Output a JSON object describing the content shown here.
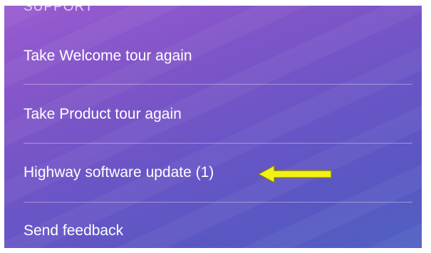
{
  "section_header": "SUPPORT",
  "menu": {
    "items": [
      {
        "label": "Take Welcome tour again"
      },
      {
        "label": "Take Product tour again"
      },
      {
        "label": "Highway software update (1)"
      },
      {
        "label": "Send feedback"
      }
    ]
  },
  "annotation": {
    "arrow_color": "#f0f215",
    "arrow_outline_color": "#8a7a10"
  }
}
